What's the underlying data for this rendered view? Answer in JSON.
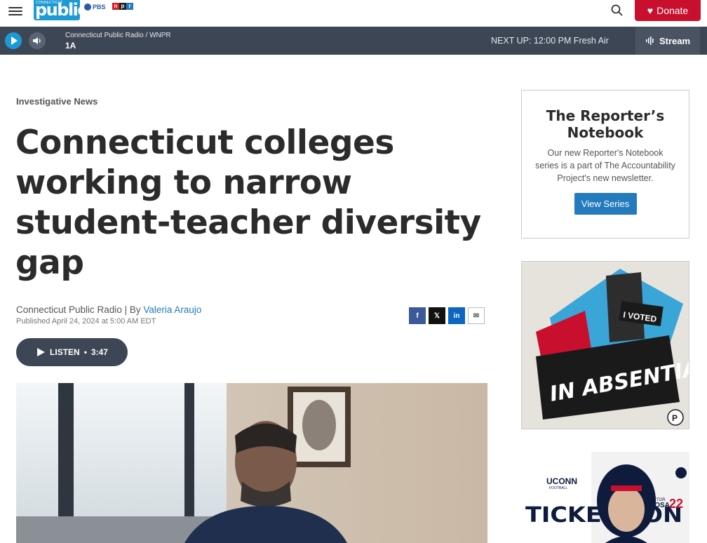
{
  "header": {
    "logo_small": "CONNECTICUT",
    "logo_main": "public",
    "pbs_label": "PBS",
    "npr_letters": [
      "n",
      "p",
      "r"
    ],
    "donate_label": "Donate"
  },
  "player": {
    "station": "Connecticut Public Radio / WNPR",
    "program": "1A",
    "next_up": "NEXT UP: 12:00 PM Fresh Air",
    "stream_label": "Stream"
  },
  "article": {
    "category": "Investigative News",
    "headline": "Connecticut colleges working to narrow student-teacher diversity gap",
    "byline_source": "Connecticut Public Radio | By ",
    "author": "Valeria Araujo",
    "published": "Published April 24, 2024 at 5:00 AM EDT",
    "share": [
      "f",
      "𝕏",
      "in",
      "✉"
    ],
    "listen_label": "LISTEN",
    "listen_separator": "•",
    "listen_duration": "3:47"
  },
  "sidebar": {
    "notebook_title": "The Reporter’s Notebook",
    "notebook_desc": "Our new Reporter's Notebook series is a part of The Accountability Project's new newsletter.",
    "notebook_button": "View Series",
    "absentia_title": "IN ABSENTIA",
    "absentia_sign": "I VOTED",
    "absentia_badge": "P",
    "uconn_brand": "UCONN",
    "uconn_sub": "FOOTBALL",
    "uconn_text": "TICKETS ON SALE",
    "uconn_player_label": "VICTOR",
    "uconn_player_name": "ROSA",
    "uconn_player_number": "22"
  },
  "colors": {
    "brand_blue": "#1b9ad6",
    "donate_red": "#c8102e",
    "player_bg": "#3d4654",
    "link_blue": "#237bbd"
  }
}
